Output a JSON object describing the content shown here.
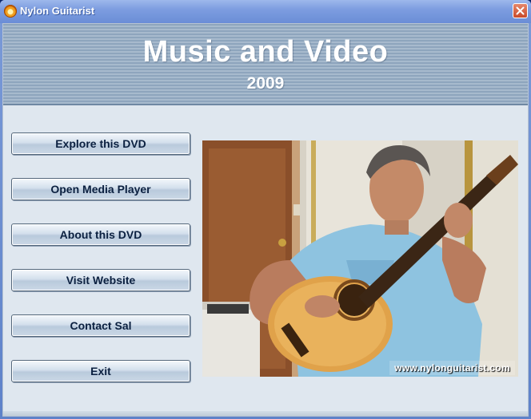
{
  "window": {
    "title": "Nylon Guitarist",
    "icon": "guitar-app-icon",
    "close_icon": "close-icon"
  },
  "header": {
    "title": "Music and Video",
    "subtitle": "2009"
  },
  "menu": {
    "items": [
      {
        "label": "Explore this DVD"
      },
      {
        "label": "Open Media Player"
      },
      {
        "label": "About this DVD"
      },
      {
        "label": "Visit Website"
      },
      {
        "label": "Contact Sal"
      },
      {
        "label": "Exit"
      }
    ]
  },
  "photo": {
    "watermark": "www.nylonguitarist.com"
  },
  "colors": {
    "titlebar": "#7d9de0",
    "close_button": "#c94a2a",
    "client_background": "#dfe7ef",
    "header_band": "#9bb0c6",
    "button_text": "#0b2040"
  }
}
